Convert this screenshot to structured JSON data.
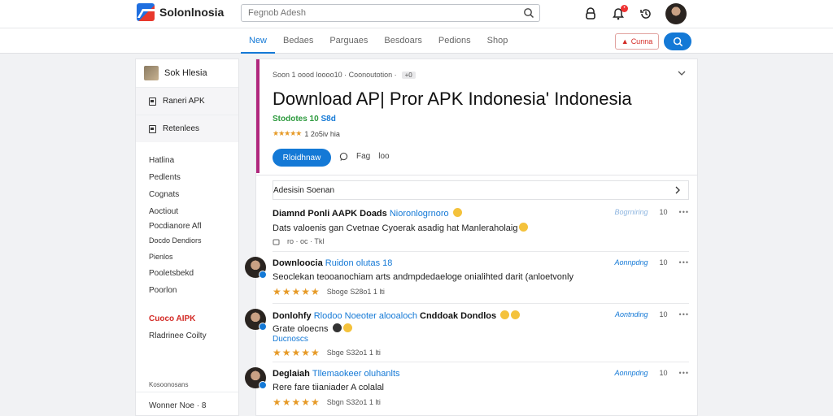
{
  "header": {
    "logo_text": "Solonlnosia",
    "search_placeholder": "Fegnob Adesh"
  },
  "nav": {
    "tabs": [
      "New",
      "Bedaes",
      "Parguaes",
      "Besdoars",
      "Pedions",
      "Shop"
    ],
    "active": 0,
    "outline_button": "Cunna"
  },
  "sidebar": {
    "user": "Sok Hlesia",
    "boxes": [
      "Raneri APK",
      "Retenlees"
    ],
    "items": [
      "Hatlina",
      "Pedlents",
      "Cognats",
      "Aoctiout",
      "Pocdianore Afl",
      "Docdo Dendiors",
      "Pienlos",
      "Pooletsbekd",
      "Poorlon"
    ],
    "red_item": "Cuoco AIPK",
    "after_red": "Rladrinee Coilty",
    "footer_small": "Kosoonosans",
    "footer": "Wonner Noe · 8"
  },
  "app": {
    "breadcrumb": "Soon 1 oood loooo10 · Coonoutotion ·",
    "breadcrumb_chip": "+0",
    "title": "Download AP| Pror APK Indonesia' Indonesia",
    "subtitle_green": "Stodotes 10",
    "subtitle_blue": "S8d",
    "rating_text": "1 2o5iv hia",
    "download_label": "Rloidhnaw",
    "like_label": "Fag",
    "like_sub": "loo"
  },
  "reviews": {
    "header": "Adesisin Soenan",
    "items": [
      {
        "title": "Diamnd Ponli AAPK Doads",
        "title_hl": "Nioronlogrnoro",
        "body": "Dats valoenis gan Cvetnae Cyoerak asadig hat Manleraholaig",
        "meta": "ro · oc · Tkl",
        "right_label": "Bogrniring",
        "count": "10"
      },
      {
        "title": "Downloocia",
        "title_hl": "Ruidon olutas 18",
        "body": "Seoclekan teooanochiam arts andmpdedaeloge onialihted darit (anloetvonly",
        "meta": "Sboge  S28o1 1 lti",
        "right_label": "Aonnpdng",
        "count": "10"
      },
      {
        "title": "Donlohfy",
        "title_hl": "Rlodoo Noeoter alooaloch",
        "title_tail": "Cnddoak Dondlos",
        "body": "Grate oloecns",
        "body_hl": "Ducnoscs",
        "meta": "Sbge  S32o1 1 lti",
        "right_label": "Aontnding",
        "count": "10"
      },
      {
        "title": "Deglaiah",
        "title_hl": "Tllemaokeer oluhanlts",
        "body": "Rere fare tiianiader A colalal",
        "meta": "Sbgn  S32o1 1 lti",
        "right_label": "Aonnpdng",
        "count": "10"
      }
    ]
  }
}
